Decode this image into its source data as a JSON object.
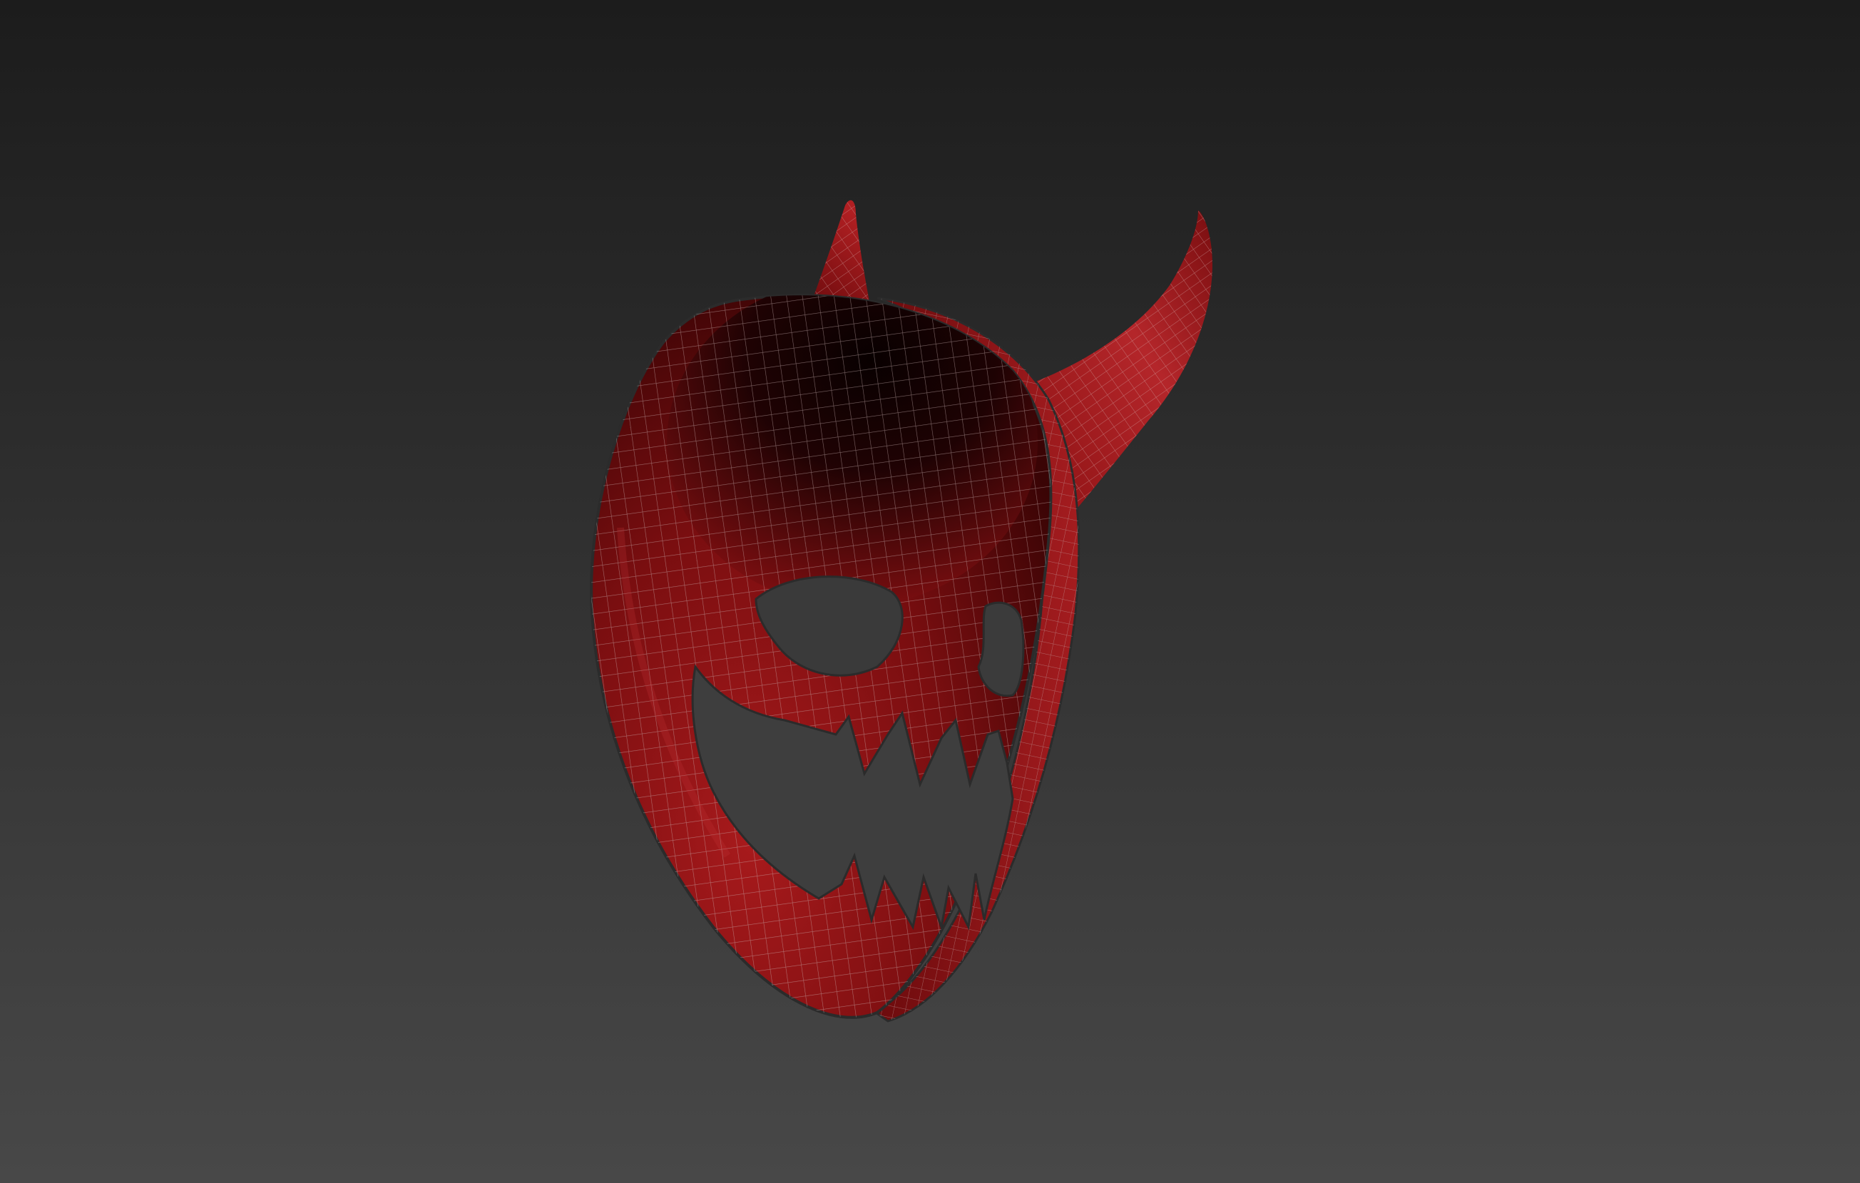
{
  "viewport": {
    "background_top": "#1c1c1c",
    "background_bottom": "#484848"
  },
  "model": {
    "name_icon": "devil-mask-icon",
    "shell_color_light": "#a81a1c",
    "shell_color_mid": "#7a0e10",
    "shell_color_dark": "#2a0203",
    "interior_color": "#050000",
    "wire_color": "#c9b3b3",
    "edge_color": "#2b2b2b"
  }
}
